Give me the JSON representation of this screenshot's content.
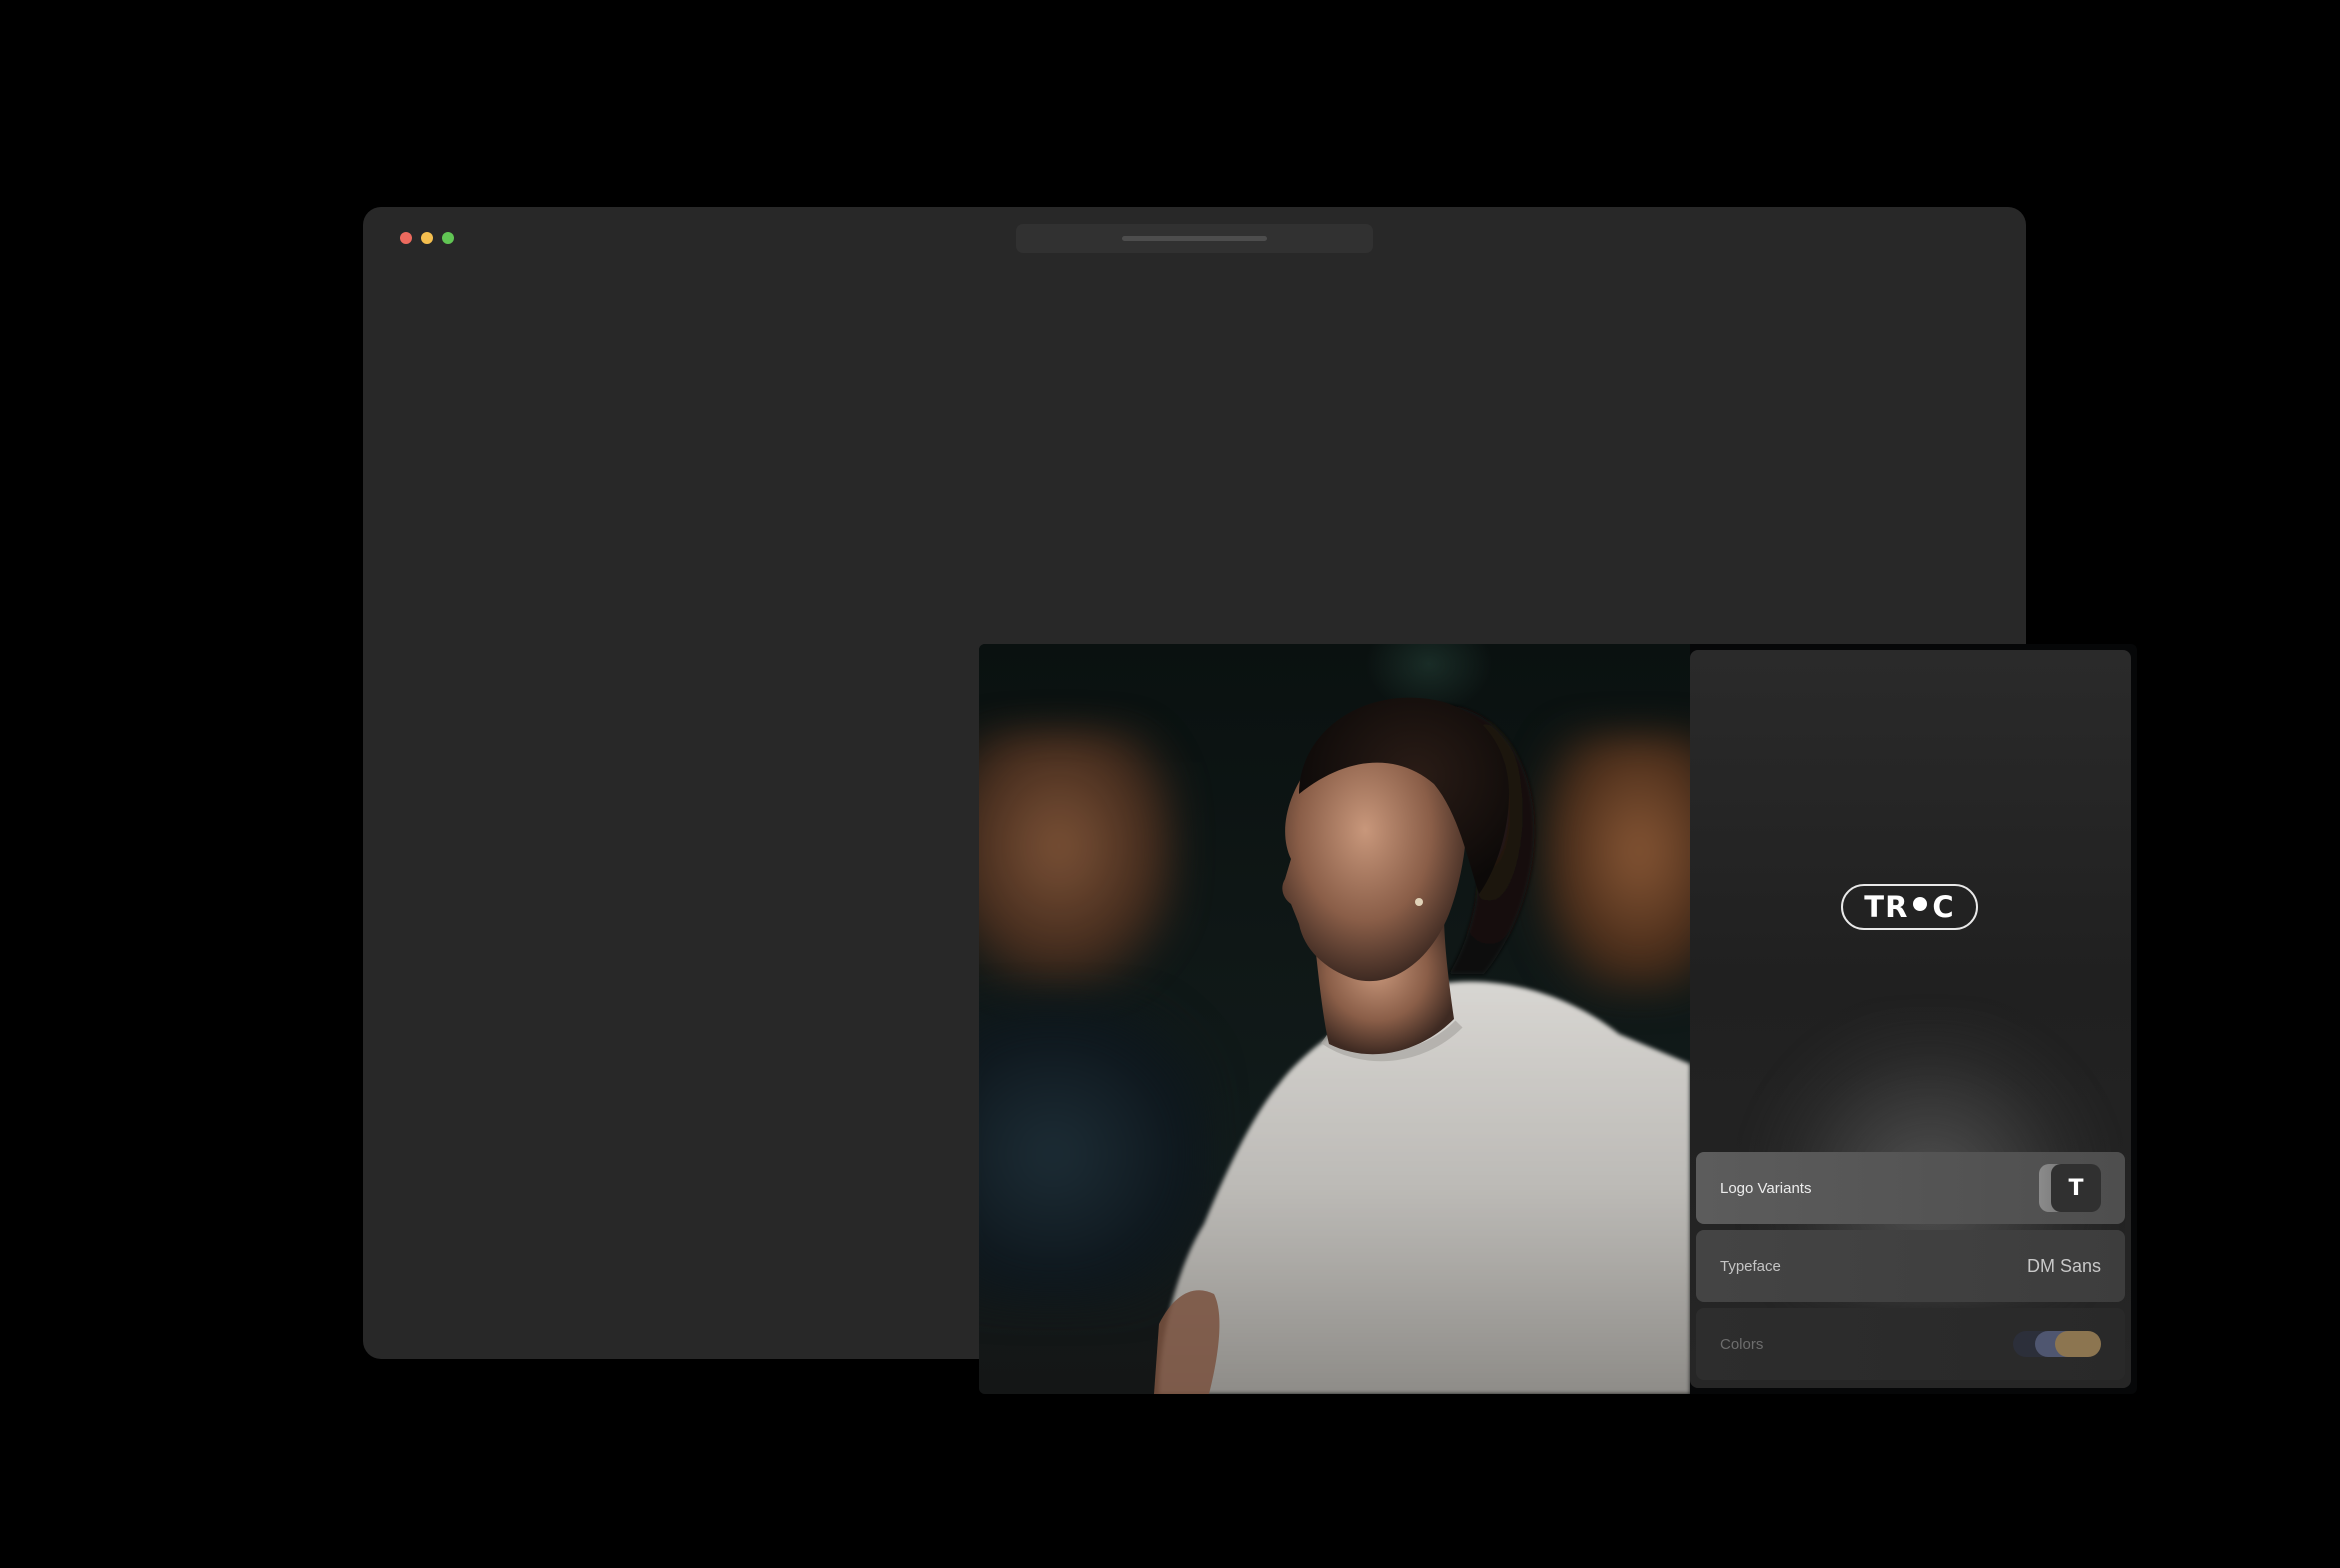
{
  "window": {
    "traffic_lights": [
      "close",
      "minimize",
      "zoom"
    ]
  },
  "photo": {
    "icon": "runner-photo"
  },
  "brand": {
    "logo_left": "TR",
    "logo_right": "C"
  },
  "rows": {
    "logo_variants": {
      "label": "Logo Variants",
      "preview": "T"
    },
    "typeface": {
      "label": "Typeface",
      "value": "DM Sans"
    },
    "colors": {
      "label": "Colors",
      "swatches": [
        "#2c2f3a",
        "#4f5670",
        "#8c7550"
      ]
    }
  }
}
